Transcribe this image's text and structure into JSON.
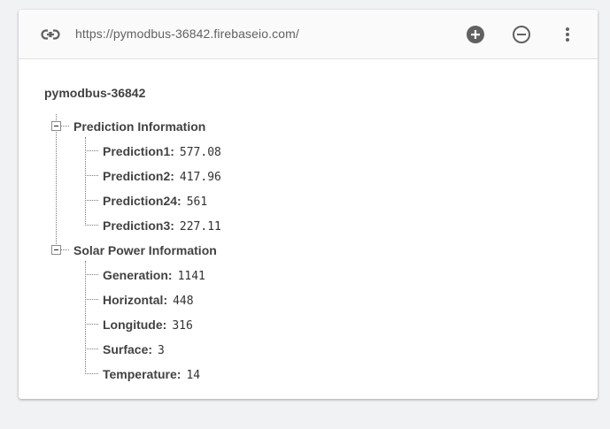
{
  "toolbar": {
    "url": "https://pymodbus-36842.firebaseio.com/",
    "icons": {
      "link": "link-icon",
      "add": "add-circle-icon",
      "remove": "remove-circle-icon",
      "more": "more-vert-icon"
    }
  },
  "tree": {
    "root": "pymodbus-36842",
    "groups": [
      {
        "name": "Prediction Information",
        "items": [
          {
            "key": "Prediction1:",
            "value": "577.08"
          },
          {
            "key": "Prediction2:",
            "value": "417.96"
          },
          {
            "key": "Prediction24:",
            "value": "561"
          },
          {
            "key": "Prediction3:",
            "value": "227.11"
          }
        ]
      },
      {
        "name": "Solar Power Information",
        "items": [
          {
            "key": "Generation:",
            "value": "1141"
          },
          {
            "key": "Horizontal:",
            "value": "448"
          },
          {
            "key": "Longitude:",
            "value": "316"
          },
          {
            "key": "Surface:",
            "value": "3"
          },
          {
            "key": "Temperature:",
            "value": "14"
          }
        ]
      }
    ]
  }
}
